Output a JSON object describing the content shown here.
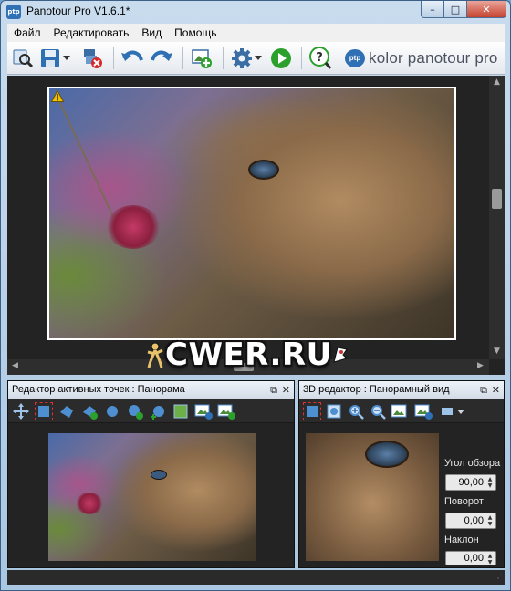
{
  "window": {
    "app_icon_text": "ptp",
    "title": "Panotour Pro V1.6.1*",
    "minimize_glyph": "–",
    "maximize_glyph": "□",
    "close_glyph": "✕"
  },
  "menu": {
    "items": [
      "Файл",
      "Редактировать",
      "Вид",
      "Помощь"
    ]
  },
  "toolbar": {
    "buttons": [
      {
        "name": "find-project-icon"
      },
      {
        "name": "save-icon"
      },
      {
        "name": "remove-project-icon"
      },
      {
        "name": "undo-icon"
      },
      {
        "name": "redo-icon"
      },
      {
        "name": "add-image-icon"
      },
      {
        "name": "settings-icon"
      },
      {
        "name": "run-build-icon"
      },
      {
        "name": "help-icon"
      }
    ],
    "brand_logo_text": "ptp",
    "brand_name": "kolor panotour pro",
    "accent": "#2f6fb3",
    "run_color": "#2ca02c"
  },
  "main_view": {
    "warning_icon": "warning-triangle-icon",
    "watermark": "CWER.RU"
  },
  "hotspot_panel": {
    "title": "Редактор активных точек : Панорама",
    "float_glyph": "⧉",
    "close_glyph": "✕",
    "tools": [
      "move-icon",
      "select-rect-icon",
      "polygon-spot-icon",
      "polygon-add-icon",
      "point-spot-icon",
      "point-add-icon",
      "point-plus-icon",
      "image-spot-icon",
      "image-import-icon",
      "image-export-icon"
    ]
  },
  "view3d_panel": {
    "title": "3D редактор : Панорамный вид",
    "float_glyph": "⧉",
    "close_glyph": "✕",
    "tools": [
      "select-rect-icon",
      "fit-view-icon",
      "zoom-in-icon",
      "zoom-out-icon",
      "snapshot-icon",
      "view-export-icon",
      "view-mode-icon"
    ],
    "fields": [
      {
        "label": "Угол обзора",
        "value": "90,00"
      },
      {
        "label": "Поворот",
        "value": "0,00"
      },
      {
        "label": "Наклон",
        "value": "0,00"
      }
    ]
  },
  "statusbar": {
    "grip": "⋰"
  }
}
